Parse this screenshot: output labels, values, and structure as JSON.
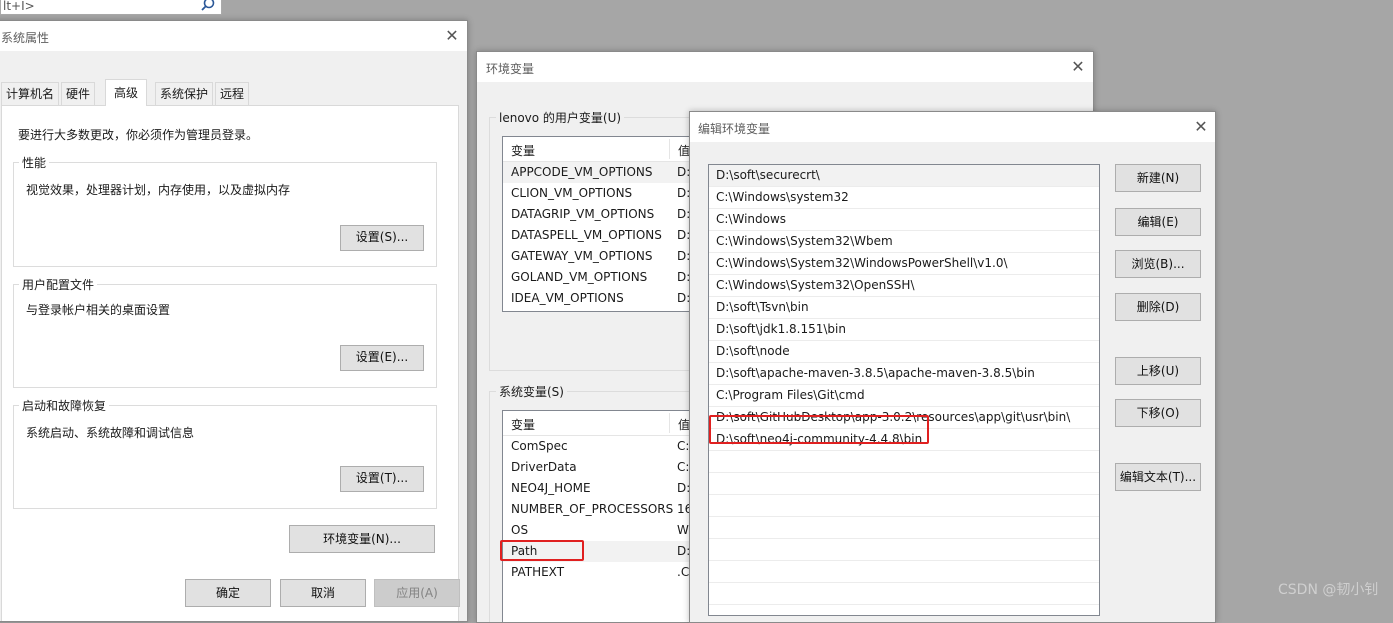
{
  "top_search": {
    "text": "lt+I>"
  },
  "system_properties": {
    "title": "系统属性",
    "tabs": [
      "计算机名",
      "硬件",
      "高级",
      "系统保护",
      "远程"
    ],
    "admin_note": "要进行大多数更改，你必须作为管理员登录。",
    "performance": {
      "label": "性能",
      "desc": "视觉效果，处理器计划，内存使用，以及虚拟内存",
      "button": "设置(S)..."
    },
    "user_profiles": {
      "label": "用户配置文件",
      "desc": "与登录帐户相关的桌面设置",
      "button": "设置(E)..."
    },
    "startup_recovery": {
      "label": "启动和故障恢复",
      "desc": "系统启动、系统故障和调试信息",
      "button": "设置(T)..."
    },
    "env_button": "环境变量(N)...",
    "ok": "确定",
    "cancel": "取消",
    "apply": "应用(A)"
  },
  "env_vars": {
    "title": "环境变量",
    "user_group": "lenovo 的用户变量(U)",
    "col_var": "变量",
    "col_val": "值",
    "user_vars": [
      {
        "name": "APPCODE_VM_OPTIONS",
        "value": "D:"
      },
      {
        "name": "CLION_VM_OPTIONS",
        "value": "D:"
      },
      {
        "name": "DATAGRIP_VM_OPTIONS",
        "value": "D:"
      },
      {
        "name": "DATASPELL_VM_OPTIONS",
        "value": "D:"
      },
      {
        "name": "GATEWAY_VM_OPTIONS",
        "value": "D:"
      },
      {
        "name": "GOLAND_VM_OPTIONS",
        "value": "D:"
      },
      {
        "name": "IDEA_VM_OPTIONS",
        "value": "D:"
      }
    ],
    "system_group": "系统变量(S)",
    "system_vars": [
      {
        "name": "ComSpec",
        "value": "C:"
      },
      {
        "name": "DriverData",
        "value": "C:"
      },
      {
        "name": "NEO4J_HOME",
        "value": "D:"
      },
      {
        "name": "NUMBER_OF_PROCESSORS",
        "value": "16"
      },
      {
        "name": "OS",
        "value": "W"
      },
      {
        "name": "Path",
        "value": "D:"
      },
      {
        "name": "PATHEXT",
        "value": ".C"
      }
    ]
  },
  "edit_env": {
    "title": "编辑环境变量",
    "paths": [
      "D:\\soft\\securecrt\\",
      "C:\\Windows\\system32",
      "C:\\Windows",
      "C:\\Windows\\System32\\Wbem",
      "C:\\Windows\\System32\\WindowsPowerShell\\v1.0\\",
      "C:\\Windows\\System32\\OpenSSH\\",
      "D:\\soft\\Tsvn\\bin",
      "D:\\soft\\jdk1.8.151\\bin",
      "D:\\soft\\node",
      "D:\\soft\\apache-maven-3.8.5\\apache-maven-3.8.5\\bin",
      "C:\\Program Files\\Git\\cmd",
      "D:\\soft\\GitHubDesktop\\app-3.0.2\\resources\\app\\git\\usr\\bin\\",
      "D:\\soft\\neo4j-community-4.4.8\\bin",
      "",
      "",
      "",
      "",
      "",
      "",
      "",
      "",
      ""
    ],
    "buttons": {
      "new": "新建(N)",
      "edit": "编辑(E)",
      "browse": "浏览(B)...",
      "delete": "删除(D)",
      "up": "上移(U)",
      "down": "下移(O)",
      "edit_text": "编辑文本(T)..."
    }
  },
  "watermark": "CSDN @韧小钊"
}
